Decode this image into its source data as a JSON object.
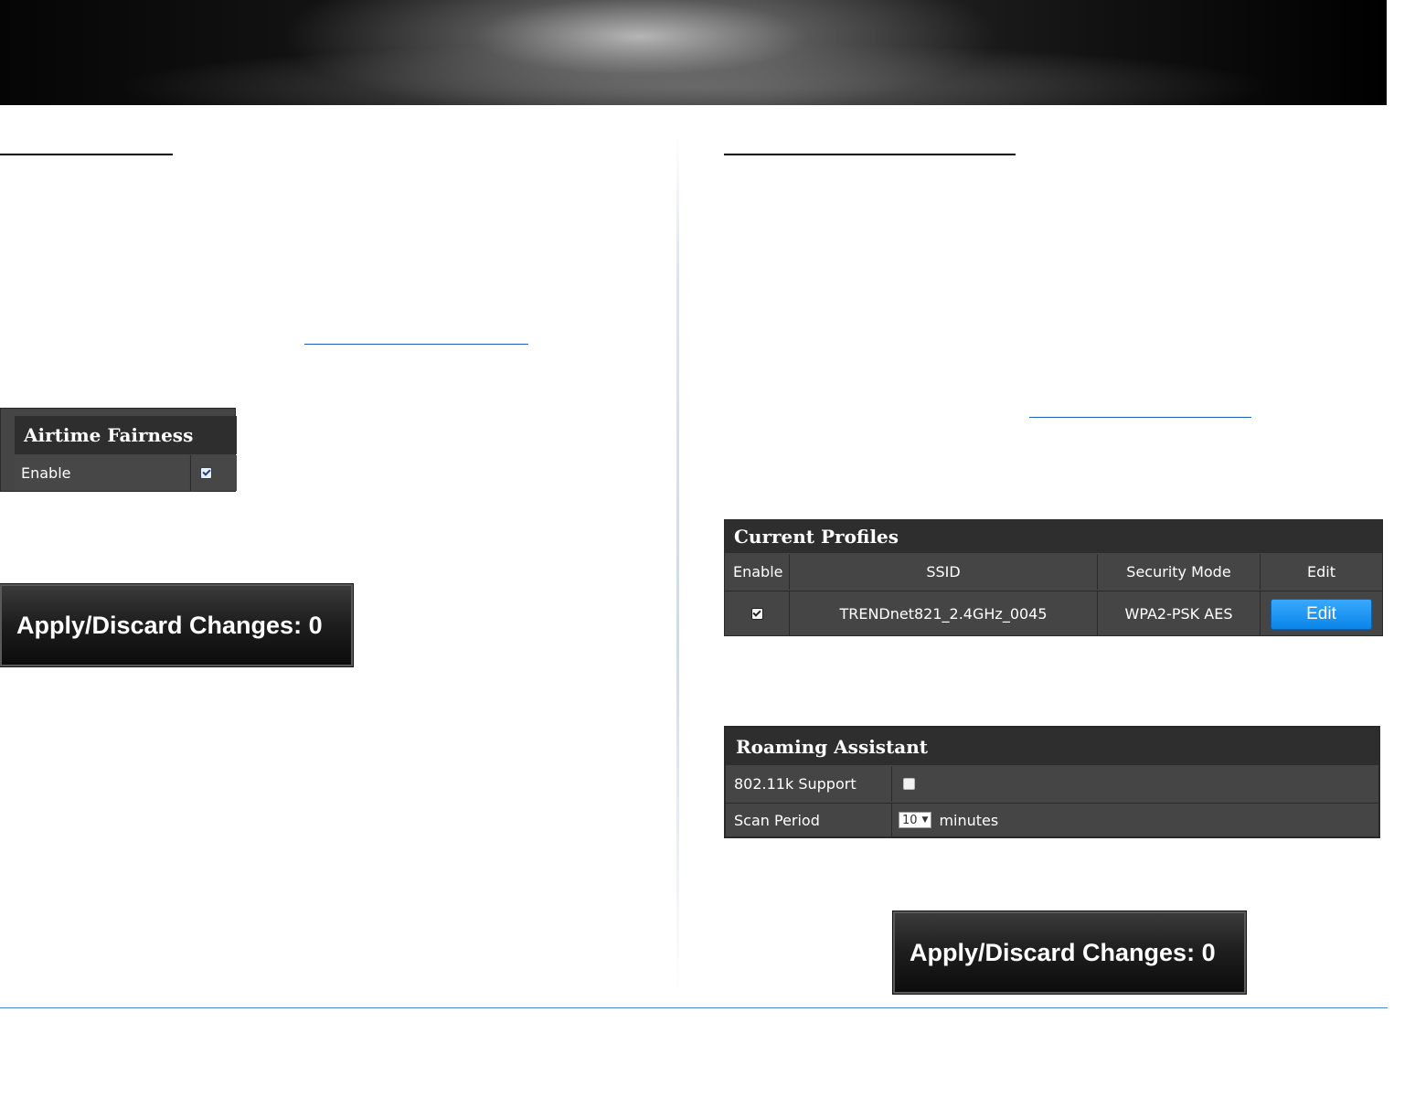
{
  "airtime": {
    "title": "Airtime Fairness",
    "enable_label": "Enable",
    "enabled": true
  },
  "apply_left": {
    "label": "Apply/Discard Changes: 0"
  },
  "profiles": {
    "title": "Current Profiles",
    "columns": [
      "Enable",
      "SSID",
      "Security Mode",
      "Edit"
    ],
    "rows": [
      {
        "enabled": true,
        "ssid": "TRENDnet821_2.4GHz_0045",
        "security": "WPA2-PSK AES",
        "edit_label": "Edit"
      }
    ]
  },
  "roaming": {
    "title": "Roaming Assistant",
    "support_label": "802.11k Support",
    "support_enabled": false,
    "scan_label": "Scan Period",
    "scan_value": "10",
    "scan_unit": "minutes"
  },
  "apply_right": {
    "label": "Apply/Discard Changes: 0"
  }
}
